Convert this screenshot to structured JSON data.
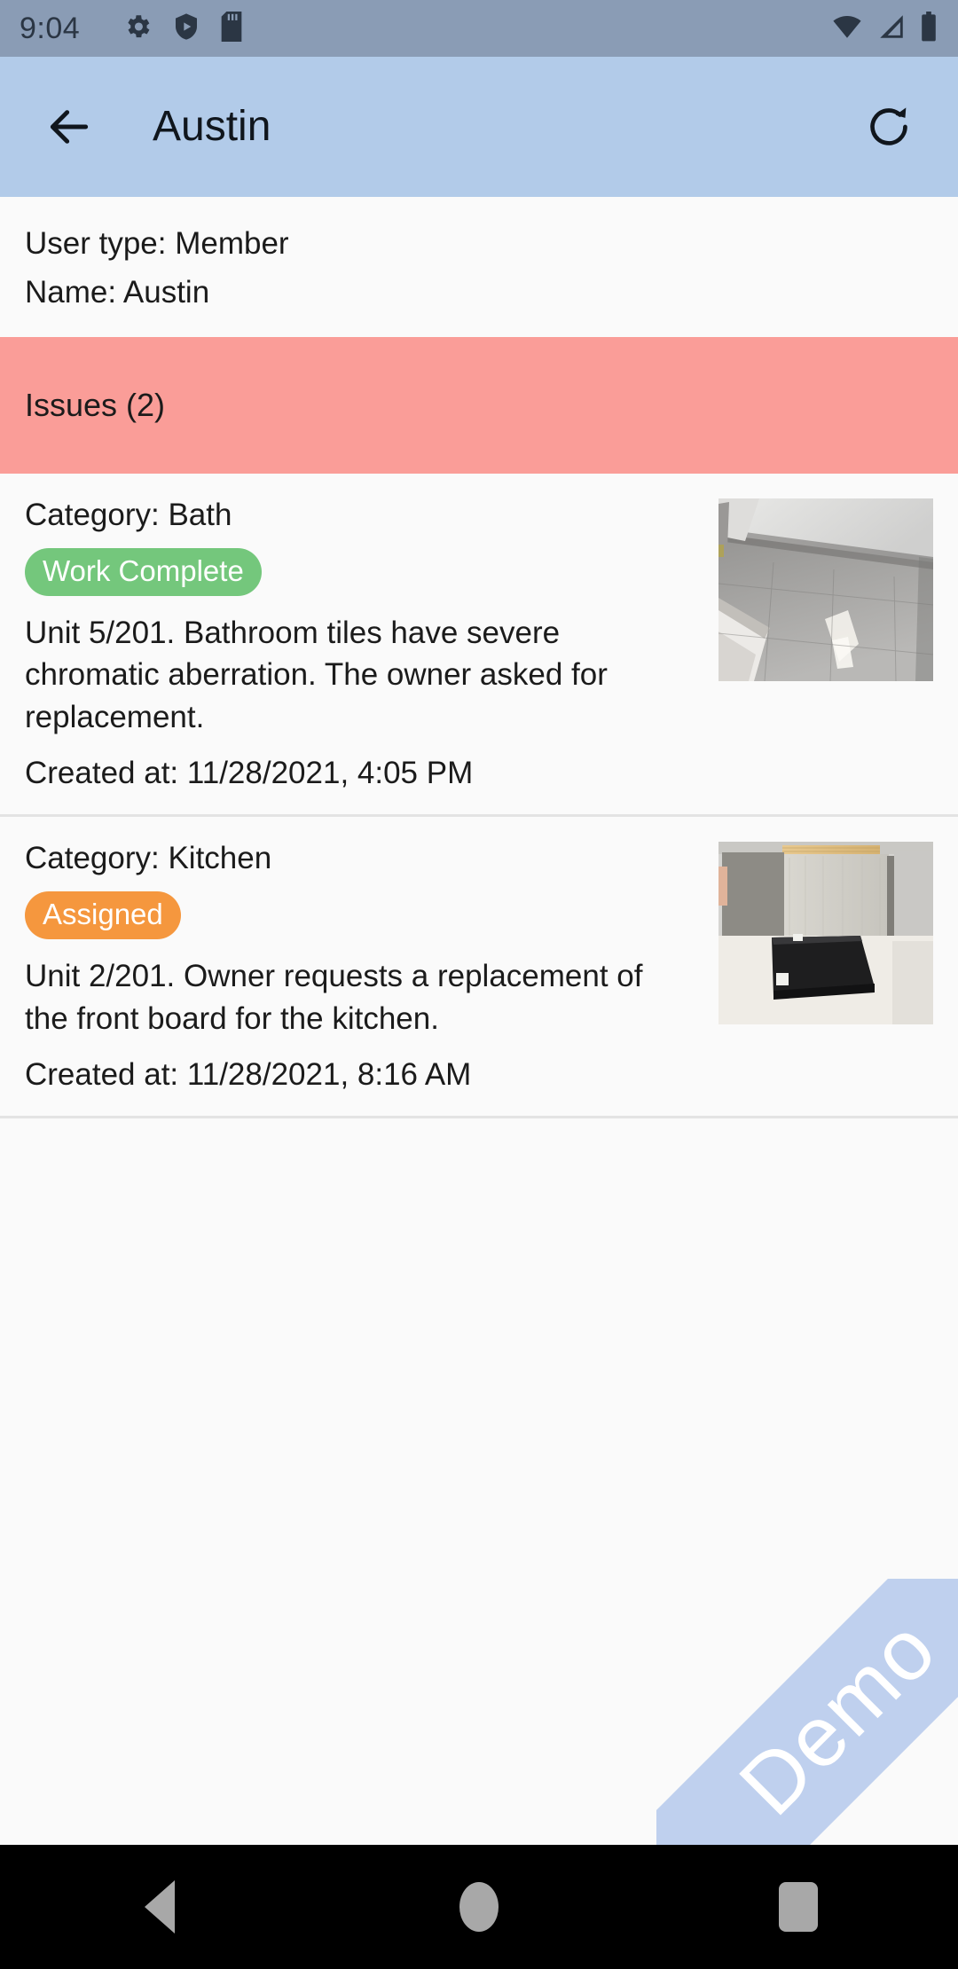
{
  "status_bar": {
    "time": "9:04",
    "left_icons": [
      "gear-icon",
      "shield-play-icon",
      "sd-card-icon"
    ],
    "right_icons": [
      "wifi-icon",
      "cellular-signal-icon",
      "battery-icon"
    ],
    "background_color": "#8a9cb5"
  },
  "app_bar": {
    "back_icon": "back-arrow-icon",
    "title": "Austin",
    "refresh_icon": "refresh-icon",
    "background_color": "#b2cbe9"
  },
  "user_info": {
    "user_type": "User type: Member",
    "name": "Name: Austin"
  },
  "issues_section": {
    "header": "Issues (2)",
    "header_color": "#fa9d98",
    "items": [
      {
        "category": "Category: Bath",
        "status": "Work Complete",
        "status_color": "#74c77c",
        "description": "Unit 5/201. Bathroom tiles have severe chromatic aberration. The owner asked for replacement.",
        "created_at": "Created at: 11/28/2021, 4:05 PM",
        "thumbnail": "bathroom-tile-floor-photo"
      },
      {
        "category": "Category: Kitchen",
        "status": "Assigned",
        "status_color": "#f5973e",
        "description": "Unit 2/201. Owner requests a replacement of the front board for the kitchen.",
        "created_at": "Created at: 11/28/2021, 8:16 AM",
        "thumbnail": "kitchen-board-samples-photo"
      }
    ]
  },
  "watermark": {
    "label": "Demo",
    "color": "#bfd0ee"
  },
  "nav_bar": {
    "back": "nav-back-icon",
    "home": "nav-home-icon",
    "recents": "nav-recents-icon"
  }
}
